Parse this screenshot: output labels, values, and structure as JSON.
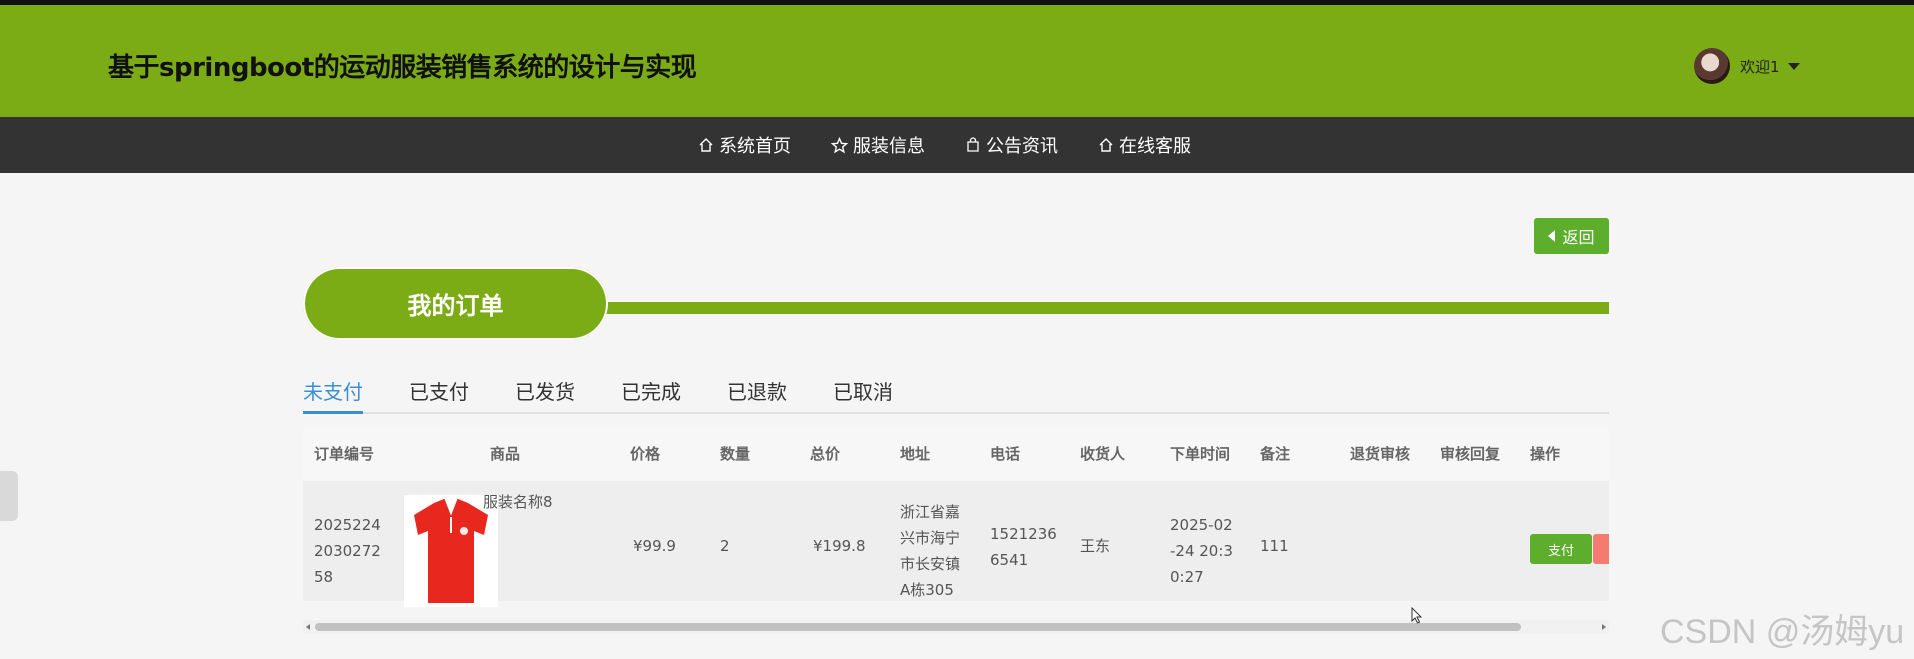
{
  "header": {
    "title": "基于springboot的运动服装销售系统的设计与实现",
    "welcome": "欢迎1",
    "bg_color": "#7bac16"
  },
  "nav": {
    "items": [
      {
        "label": "系统首页",
        "icon": "home-icon"
      },
      {
        "label": "服装信息",
        "icon": "star-icon"
      },
      {
        "label": "公告资讯",
        "icon": "bag-icon"
      },
      {
        "label": "在线客服",
        "icon": "home-icon"
      }
    ]
  },
  "back_label": "返回",
  "section_title": "我的订单",
  "tabs": [
    "未支付",
    "已支付",
    "已发货",
    "已完成",
    "已退款",
    "已取消"
  ],
  "active_tab": "未支付",
  "table": {
    "headers": [
      "订单编号",
      "商品",
      "价格",
      "数量",
      "总价",
      "地址",
      "电话",
      "收货人",
      "下单时间",
      "备注",
      "退货审核",
      "审核回复",
      "操作"
    ],
    "rows": [
      {
        "order_no_lines": [
          "2025224",
          "2030272",
          "58"
        ],
        "product_name": "服装名称8",
        "price": "¥99.9",
        "qty": "2",
        "total": "¥199.8",
        "address_lines": [
          "浙江省嘉",
          "兴市海宁",
          "市长安镇",
          "A栋305"
        ],
        "phone_lines": [
          "1521236",
          "6541"
        ],
        "receiver": "王东",
        "time_lines": [
          "2025-02",
          "-24 20:3",
          "0:27"
        ],
        "note": "111",
        "return_review": "",
        "review_reply": "",
        "pay_label": "支付"
      }
    ]
  },
  "watermark": "CSDN @汤姆yu"
}
